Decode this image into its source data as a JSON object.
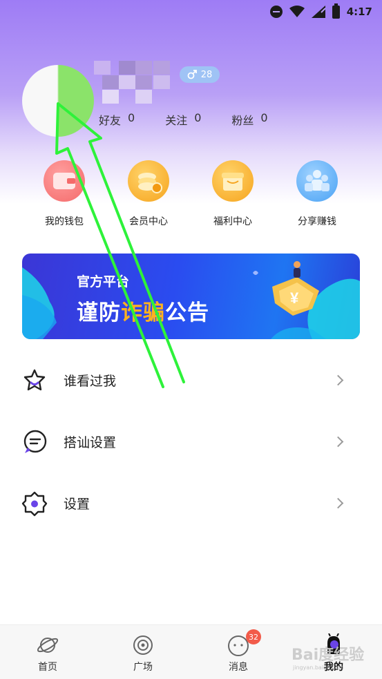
{
  "status_bar": {
    "time": "4:17",
    "icons": [
      "do-not-disturb-icon",
      "wifi-icon",
      "signal-icon",
      "battery-icon"
    ]
  },
  "profile": {
    "gender_age_badge": {
      "icon": "male-icon",
      "age": "28"
    },
    "stats": [
      {
        "label": "好友",
        "value": "0"
      },
      {
        "label": "关注",
        "value": "0"
      },
      {
        "label": "粉丝",
        "value": "0"
      }
    ]
  },
  "quick_entries": [
    {
      "label": "我的钱包",
      "icon": "wallet-icon",
      "color": "#f46a6a"
    },
    {
      "label": "会员中心",
      "icon": "coins-icon",
      "color": "#f6a41d"
    },
    {
      "label": "福利中心",
      "icon": "gift-icon",
      "color": "#f6a41d"
    },
    {
      "label": "分享赚钱",
      "icon": "people-icon",
      "color": "#4aa2f4"
    }
  ],
  "banner": {
    "small_text": "官方平台",
    "big_text_1": "谨防",
    "big_text_highlight": "诈骗",
    "big_text_2": "公告"
  },
  "menu": [
    {
      "label": "谁看过我",
      "icon": "star-icon"
    },
    {
      "label": "搭讪设置",
      "icon": "chat-bubble-icon"
    },
    {
      "label": "设置",
      "icon": "gear-icon"
    }
  ],
  "tabbar": {
    "tabs": [
      {
        "label": "首页",
        "icon": "planet-icon",
        "active": false
      },
      {
        "label": "广场",
        "icon": "target-icon",
        "active": false
      },
      {
        "label": "消息",
        "icon": "message-face-icon",
        "active": false,
        "badge": "32"
      },
      {
        "label": "我的",
        "icon": "profile-creature-icon",
        "active": true
      }
    ]
  },
  "colors": {
    "accent_purple": "#6a44e8",
    "header_gradient_top": "#9e7cf5",
    "badge_red": "#f25b4a",
    "annotation_green": "#2ef23a"
  }
}
